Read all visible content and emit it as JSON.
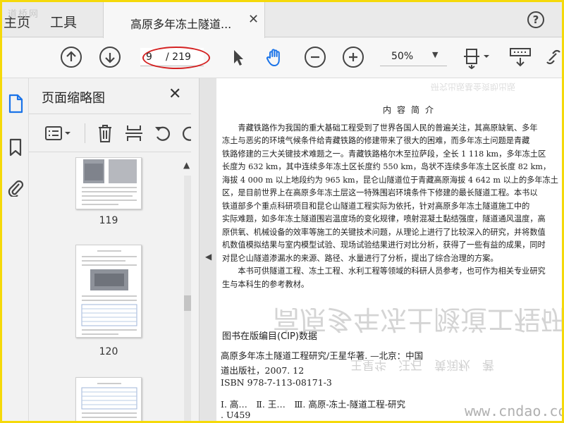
{
  "watermark_top": "道桥网",
  "tabs": {
    "home": "主页",
    "tools": "工具",
    "document": "高原多年冻土隧道..."
  },
  "help_glyph": "?",
  "toolbar": {
    "page_current": "9",
    "page_total": "/ 219",
    "zoom": "50%"
  },
  "panel": {
    "title": "页面缩略图",
    "close_glyph": "✕",
    "thumbnails": [
      {
        "label": "119"
      },
      {
        "label": "120"
      },
      {
        "label": ""
      }
    ]
  },
  "document": {
    "ghost_header": "研究出版基金资助出版",
    "intro_heading": "内容简介",
    "paragraphs": [
      "　　青藏铁路作为我国的重大基础工程受到了世界各国人民的普遍关注，其高原缺氧、多年",
      "冻土与恶劣的环境气候条件给青藏铁路的修建带来了很大的困难，而多年冻土问题是青藏",
      "铁路修建的三大关键技术难题之一。青藏铁路格尔木至拉萨段，全长 1 118 km，多年冻土区",
      "长度为 632 km，其中连续多年冻土区长度约 550 km，岛状不连续多年冻土区长度 82 km，",
      "海拔 4 000 m 以上地段约为 965 km，昆仑山隧道位于青藏高原海拔 4 642 m 以上的多年冻土",
      "区，是目前世界上在高原多年冻土层这一特殊围岩环境条件下修建的最长隧道工程。本书以",
      "铁道部多个重点科研项目和昆仑山隧道工程实际为依托，针对高原多年冻土隧道施工中的",
      "实际难题，如多年冻土隧道围岩温度场的变化规律，喷射混凝土黏结强度，隧道通风温度，高",
      "原供氧、机械设备的效率等施工的关键技术问题，从理论上进行了比较深入的研究，并将数值",
      "机数值模拟结果与室内模型试验、现场试验结果进行对比分析，获得了一些有益的成果，同时",
      "对昆仑山隧道渗漏水的来源、路径、水量进行了分析，提出了综合治理的方案。",
      "　　本书可供隧道工程、冻土工程、水利工程等领域的科研人员参考，也可作为相关专业研究",
      "生与本科生的参考教材。"
    ],
    "ghost_title": "高原多年冻土隧道工程研究",
    "ghost_author": "王星华　汪石　黄润秋　著",
    "cip_heading": "图书在版编目(CIP)数据",
    "cip_lines": [
      "高原多年冻土隧道工程研究/王星华著. —北京：中国",
      "道出版社，2007. 12",
      "ISBN 978-7-113-08171-3",
      "Ⅰ. 高…　Ⅱ. 王…　Ⅲ. 高原-冻土-隧道工程-研究",
      ". U459"
    ]
  },
  "site_watermark": "www.cndao.com",
  "colors": {
    "frame": "#f5d90a",
    "annotation_oval": "#d42222",
    "hand_tool": "#1a73e8"
  }
}
